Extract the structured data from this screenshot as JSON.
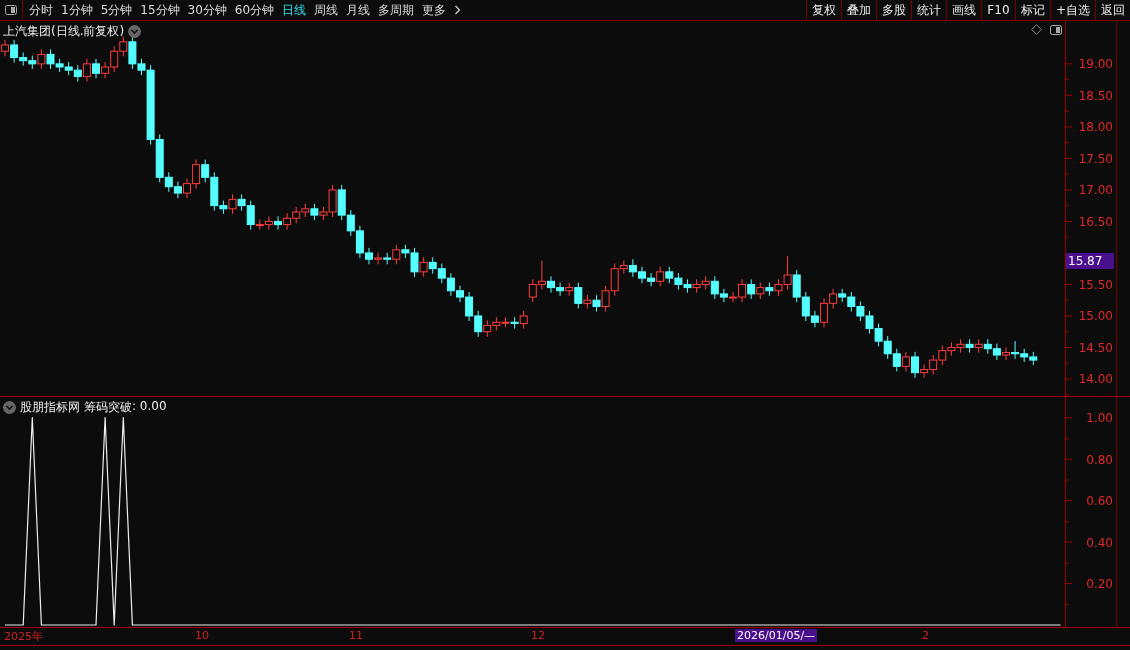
{
  "toolbar": {
    "periods": [
      {
        "label": "分时",
        "selected": false
      },
      {
        "label": "1分钟",
        "selected": false
      },
      {
        "label": "5分钟",
        "selected": false
      },
      {
        "label": "15分钟",
        "selected": false
      },
      {
        "label": "30分钟",
        "selected": false
      },
      {
        "label": "60分钟",
        "selected": false
      },
      {
        "label": "日线",
        "selected": true
      },
      {
        "label": "周线",
        "selected": false
      },
      {
        "label": "月线",
        "selected": false
      },
      {
        "label": "多周期",
        "selected": false
      },
      {
        "label": "更多",
        "selected": false
      }
    ],
    "buttons": [
      "复权",
      "叠加",
      "多股",
      "统计",
      "画线",
      "F10",
      "标记",
      "+自选",
      "返回"
    ]
  },
  "main_chart": {
    "title": "上汽集团(日线.前复权)",
    "last_price": "15.87",
    "chart_data": {
      "type": "candlestick",
      "ylim": [
        13.73,
        19.68
      ],
      "yticks": [
        {
          "value": 19,
          "label": "19.00"
        },
        {
          "value": 18.5,
          "label": "18.50"
        },
        {
          "value": 18,
          "label": "18.00"
        },
        {
          "value": 17.5,
          "label": "17.50"
        },
        {
          "value": 17,
          "label": "17.00"
        },
        {
          "value": 16.5,
          "label": "16.50"
        },
        {
          "value": 15.5,
          "label": "15.50"
        },
        {
          "value": 15,
          "label": "15.00"
        },
        {
          "value": 14.5,
          "label": "14.50"
        },
        {
          "value": 14,
          "label": "14.00"
        }
      ],
      "ohlc": [
        [
          19.2,
          19.38,
          19.12,
          19.3
        ],
        [
          19.3,
          19.38,
          19.02,
          19.1
        ],
        [
          19.1,
          19.18,
          18.97,
          19.05
        ],
        [
          19.05,
          19.13,
          18.92,
          19.0
        ],
        [
          19.0,
          19.23,
          18.92,
          19.15
        ],
        [
          19.15,
          19.23,
          18.92,
          19.0
        ],
        [
          19.0,
          19.08,
          18.87,
          18.95
        ],
        [
          18.95,
          19.03,
          18.82,
          18.9
        ],
        [
          18.9,
          18.98,
          18.72,
          18.8
        ],
        [
          18.8,
          19.08,
          18.72,
          19.0
        ],
        [
          19.0,
          19.08,
          18.77,
          18.85
        ],
        [
          18.85,
          19.03,
          18.77,
          18.95
        ],
        [
          18.95,
          19.28,
          18.87,
          19.2
        ],
        [
          19.2,
          19.43,
          19.12,
          19.35
        ],
        [
          19.35,
          19.43,
          18.92,
          19.0
        ],
        [
          19.0,
          19.08,
          18.82,
          18.9
        ],
        [
          18.9,
          18.98,
          17.72,
          17.8
        ],
        [
          17.8,
          17.88,
          17.12,
          17.2
        ],
        [
          17.2,
          17.28,
          16.97,
          17.05
        ],
        [
          17.05,
          17.13,
          16.87,
          16.95
        ],
        [
          16.95,
          17.18,
          16.87,
          17.1
        ],
        [
          17.1,
          17.48,
          17.02,
          17.4
        ],
        [
          17.4,
          17.48,
          17.12,
          17.2
        ],
        [
          17.2,
          17.28,
          16.67,
          16.75
        ],
        [
          16.75,
          16.83,
          16.62,
          16.7
        ],
        [
          16.7,
          16.93,
          16.62,
          16.85
        ],
        [
          16.85,
          16.93,
          16.67,
          16.75
        ],
        [
          16.75,
          16.83,
          16.37,
          16.45
        ],
        [
          16.45,
          16.53,
          16.37,
          16.45
        ],
        [
          16.45,
          16.58,
          16.37,
          16.5
        ],
        [
          16.5,
          16.58,
          16.37,
          16.45
        ],
        [
          16.45,
          16.63,
          16.37,
          16.55
        ],
        [
          16.55,
          16.73,
          16.47,
          16.65
        ],
        [
          16.65,
          16.78,
          16.57,
          16.7
        ],
        [
          16.7,
          16.78,
          16.52,
          16.6
        ],
        [
          16.6,
          16.73,
          16.52,
          16.65
        ],
        [
          16.65,
          17.08,
          16.57,
          17.0
        ],
        [
          17.0,
          17.08,
          16.52,
          16.6
        ],
        [
          16.6,
          16.68,
          16.27,
          16.35
        ],
        [
          16.35,
          16.43,
          15.92,
          16.0
        ],
        [
          16.0,
          16.08,
          15.82,
          15.9
        ],
        [
          15.9,
          16.0,
          15.82,
          15.92
        ],
        [
          15.92,
          16.0,
          15.82,
          15.9
        ],
        [
          15.9,
          16.13,
          15.82,
          16.05
        ],
        [
          16.05,
          16.13,
          15.92,
          16.0
        ],
        [
          16.0,
          16.08,
          15.62,
          15.7
        ],
        [
          15.7,
          15.93,
          15.62,
          15.85
        ],
        [
          15.85,
          15.93,
          15.67,
          15.75
        ],
        [
          15.75,
          15.83,
          15.52,
          15.6
        ],
        [
          15.6,
          15.68,
          15.32,
          15.4
        ],
        [
          15.4,
          15.48,
          15.22,
          15.3
        ],
        [
          15.3,
          15.38,
          14.92,
          15.0
        ],
        [
          15.0,
          15.08,
          14.67,
          14.75
        ],
        [
          14.75,
          14.93,
          14.67,
          14.85
        ],
        [
          14.85,
          14.98,
          14.77,
          14.9
        ],
        [
          14.9,
          14.98,
          14.82,
          14.9
        ],
        [
          14.9,
          14.98,
          14.8,
          14.88
        ],
        [
          14.88,
          15.08,
          14.8,
          15.0
        ],
        [
          15.3,
          15.58,
          15.22,
          15.5
        ],
        [
          15.5,
          15.88,
          15.42,
          15.55
        ],
        [
          15.55,
          15.63,
          15.37,
          15.45
        ],
        [
          15.45,
          15.53,
          15.32,
          15.4
        ],
        [
          15.4,
          15.53,
          15.32,
          15.45
        ],
        [
          15.45,
          15.53,
          15.12,
          15.2
        ],
        [
          15.2,
          15.33,
          15.12,
          15.25
        ],
        [
          15.25,
          15.33,
          15.07,
          15.15
        ],
        [
          15.15,
          15.48,
          15.07,
          15.4
        ],
        [
          15.4,
          15.83,
          15.32,
          15.75
        ],
        [
          15.75,
          15.88,
          15.67,
          15.8
        ],
        [
          15.8,
          15.9,
          15.62,
          15.7
        ],
        [
          15.7,
          15.78,
          15.52,
          15.6
        ],
        [
          15.6,
          15.68,
          15.47,
          15.55
        ],
        [
          15.55,
          15.78,
          15.47,
          15.7
        ],
        [
          15.7,
          15.78,
          15.52,
          15.6
        ],
        [
          15.6,
          15.68,
          15.42,
          15.5
        ],
        [
          15.5,
          15.58,
          15.37,
          15.45
        ],
        [
          15.45,
          15.58,
          15.37,
          15.5
        ],
        [
          15.5,
          15.63,
          15.42,
          15.55
        ],
        [
          15.55,
          15.63,
          15.27,
          15.35
        ],
        [
          15.35,
          15.43,
          15.22,
          15.3
        ],
        [
          15.3,
          15.38,
          15.22,
          15.3
        ],
        [
          15.3,
          15.58,
          15.22,
          15.5
        ],
        [
          15.5,
          15.58,
          15.27,
          15.35
        ],
        [
          15.35,
          15.53,
          15.27,
          15.45
        ],
        [
          15.45,
          15.53,
          15.32,
          15.4
        ],
        [
          15.4,
          15.58,
          15.32,
          15.5
        ],
        [
          15.5,
          15.95,
          15.42,
          15.65
        ],
        [
          15.65,
          15.73,
          15.22,
          15.3
        ],
        [
          15.3,
          15.38,
          14.92,
          15.0
        ],
        [
          15.0,
          15.08,
          14.82,
          14.9
        ],
        [
          14.9,
          15.28,
          14.82,
          15.2
        ],
        [
          15.2,
          15.43,
          15.12,
          15.35
        ],
        [
          15.35,
          15.43,
          15.22,
          15.3
        ],
        [
          15.3,
          15.38,
          15.07,
          15.15
        ],
        [
          15.15,
          15.23,
          14.92,
          15.0
        ],
        [
          15.0,
          15.08,
          14.72,
          14.8
        ],
        [
          14.8,
          14.88,
          14.52,
          14.6
        ],
        [
          14.6,
          14.68,
          14.32,
          14.4
        ],
        [
          14.4,
          14.48,
          14.12,
          14.2
        ],
        [
          14.2,
          14.43,
          14.12,
          14.35
        ],
        [
          14.35,
          14.43,
          14.02,
          14.1
        ],
        [
          14.1,
          14.23,
          14.02,
          14.15
        ],
        [
          14.15,
          14.38,
          14.07,
          14.3
        ],
        [
          14.3,
          14.53,
          14.22,
          14.45
        ],
        [
          14.45,
          14.58,
          14.37,
          14.5
        ],
        [
          14.5,
          14.63,
          14.42,
          14.55
        ],
        [
          14.55,
          14.63,
          14.42,
          14.5
        ],
        [
          14.5,
          14.63,
          14.42,
          14.55
        ],
        [
          14.55,
          14.63,
          14.4,
          14.48
        ],
        [
          14.48,
          14.56,
          14.3,
          14.38
        ],
        [
          14.38,
          14.5,
          14.3,
          14.42
        ],
        [
          14.42,
          14.6,
          14.32,
          14.4
        ],
        [
          14.4,
          14.48,
          14.27,
          14.35
        ],
        [
          14.35,
          14.43,
          14.22,
          14.3
        ]
      ]
    }
  },
  "indicator": {
    "title": "股朋指标网",
    "reading": ": 0.00",
    "chart_data": {
      "type": "line",
      "ylim": [
        0,
        1.1
      ],
      "yticks": [
        {
          "value": 1,
          "label": "1.00"
        },
        {
          "value": 0.8,
          "label": "0.80"
        },
        {
          "value": 0.6,
          "label": "0.60"
        },
        {
          "value": 0.4,
          "label": "0.40"
        },
        {
          "value": 0.2,
          "label": "0.20"
        }
      ],
      "series": [
        {
          "name": "筹码突破",
          "color": "#eeeeee",
          "values": [
            0,
            0,
            0,
            1,
            0,
            0,
            0,
            0,
            0,
            0,
            0,
            1,
            0,
            1,
            0,
            0,
            0,
            0,
            0,
            0,
            0,
            0,
            0,
            0,
            0,
            0,
            0,
            0,
            0,
            0,
            0,
            0,
            0,
            0,
            0,
            0,
            0,
            0,
            0,
            0,
            0,
            0,
            0,
            0,
            0,
            0,
            0,
            0,
            0,
            0,
            0,
            0,
            0,
            0,
            0,
            0,
            0,
            0,
            0,
            0,
            0,
            0,
            0,
            0,
            0,
            0,
            0,
            0,
            0,
            0,
            0,
            0,
            0,
            0,
            0,
            0,
            0,
            0,
            0,
            0,
            0,
            0,
            0,
            0,
            0,
            0,
            0,
            0,
            0,
            0,
            0,
            0,
            0,
            0,
            0,
            0,
            0,
            0,
            0,
            0,
            0,
            0,
            0,
            0,
            0,
            0,
            0,
            0,
            0,
            0,
            0,
            0,
            0,
            0,
            0,
            0,
            0
          ]
        }
      ]
    }
  },
  "date_axis": [
    {
      "label": "2025年",
      "kind": "plain"
    },
    {
      "label": "10",
      "kind": "plain"
    },
    {
      "label": "11",
      "kind": "plain"
    },
    {
      "label": "12",
      "kind": "plain"
    },
    {
      "label": "2026/01/05/—",
      "kind": "cursor"
    },
    {
      "label": "2",
      "kind": "plain"
    }
  ]
}
